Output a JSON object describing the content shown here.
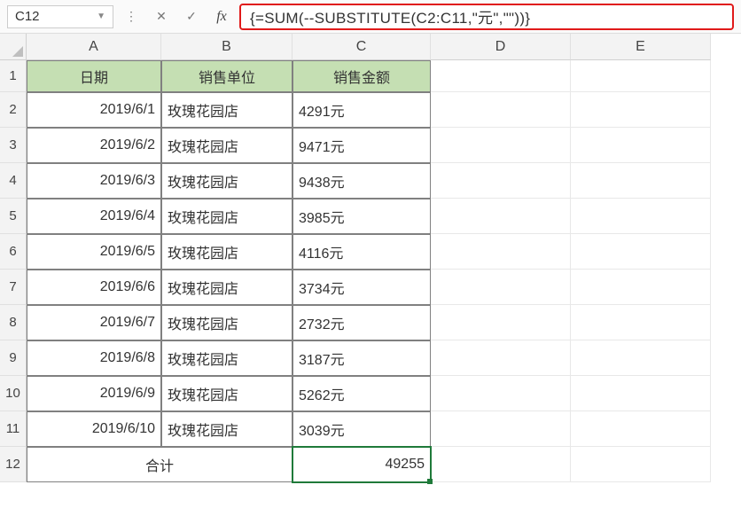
{
  "name_box": {
    "value": "C12"
  },
  "formula_bar": {
    "cancel_glyph": "✕",
    "confirm_glyph": "✓",
    "fx_label": "fx",
    "formula": "{=SUM(--SUBSTITUTE(C2:C11,\"元\",\"\"))}"
  },
  "columns": [
    {
      "letter": "A",
      "width": 152
    },
    {
      "letter": "B",
      "width": 148
    },
    {
      "letter": "C",
      "width": 156
    },
    {
      "letter": "D",
      "width": 158
    },
    {
      "letter": "E",
      "width": 158
    }
  ],
  "row_heights": {
    "header": 36,
    "data": 40
  },
  "headers": {
    "date": "日期",
    "branch": "销售单位",
    "amount": "销售金额"
  },
  "rows": [
    {
      "date": "2019/6/1",
      "branch": "玫瑰花园店",
      "amount": "4291元"
    },
    {
      "date": "2019/6/2",
      "branch": "玫瑰花园店",
      "amount": "9471元"
    },
    {
      "date": "2019/6/3",
      "branch": "玫瑰花园店",
      "amount": "9438元"
    },
    {
      "date": "2019/6/4",
      "branch": "玫瑰花园店",
      "amount": "3985元"
    },
    {
      "date": "2019/6/5",
      "branch": "玫瑰花园店",
      "amount": "4116元"
    },
    {
      "date": "2019/6/6",
      "branch": "玫瑰花园店",
      "amount": "3734元"
    },
    {
      "date": "2019/6/7",
      "branch": "玫瑰花园店",
      "amount": "2732元"
    },
    {
      "date": "2019/6/8",
      "branch": "玫瑰花园店",
      "amount": "3187元"
    },
    {
      "date": "2019/6/9",
      "branch": "玫瑰花园店",
      "amount": "5262元"
    },
    {
      "date": "2019/6/10",
      "branch": "玫瑰花园店",
      "amount": "3039元"
    }
  ],
  "footer": {
    "label": "合计",
    "total": "49255"
  },
  "active_cell": "C12",
  "chart_data": {
    "type": "table",
    "title": "销售金额",
    "columns": [
      "日期",
      "销售单位",
      "销售金额"
    ],
    "rows": [
      [
        "2019/6/1",
        "玫瑰花园店",
        "4291元"
      ],
      [
        "2019/6/2",
        "玫瑰花园店",
        "9471元"
      ],
      [
        "2019/6/3",
        "玫瑰花园店",
        "9438元"
      ],
      [
        "2019/6/4",
        "玫瑰花园店",
        "3985元"
      ],
      [
        "2019/6/5",
        "玫瑰花园店",
        "4116元"
      ],
      [
        "2019/6/6",
        "玫瑰花园店",
        "3734元"
      ],
      [
        "2019/6/7",
        "玫瑰花园店",
        "2732元"
      ],
      [
        "2019/6/8",
        "玫瑰花园店",
        "3187元"
      ],
      [
        "2019/6/9",
        "玫瑰花园店",
        "5262元"
      ],
      [
        "2019/6/10",
        "玫瑰花园店",
        "3039元"
      ]
    ],
    "footer": [
      "合计",
      "",
      "49255"
    ]
  }
}
